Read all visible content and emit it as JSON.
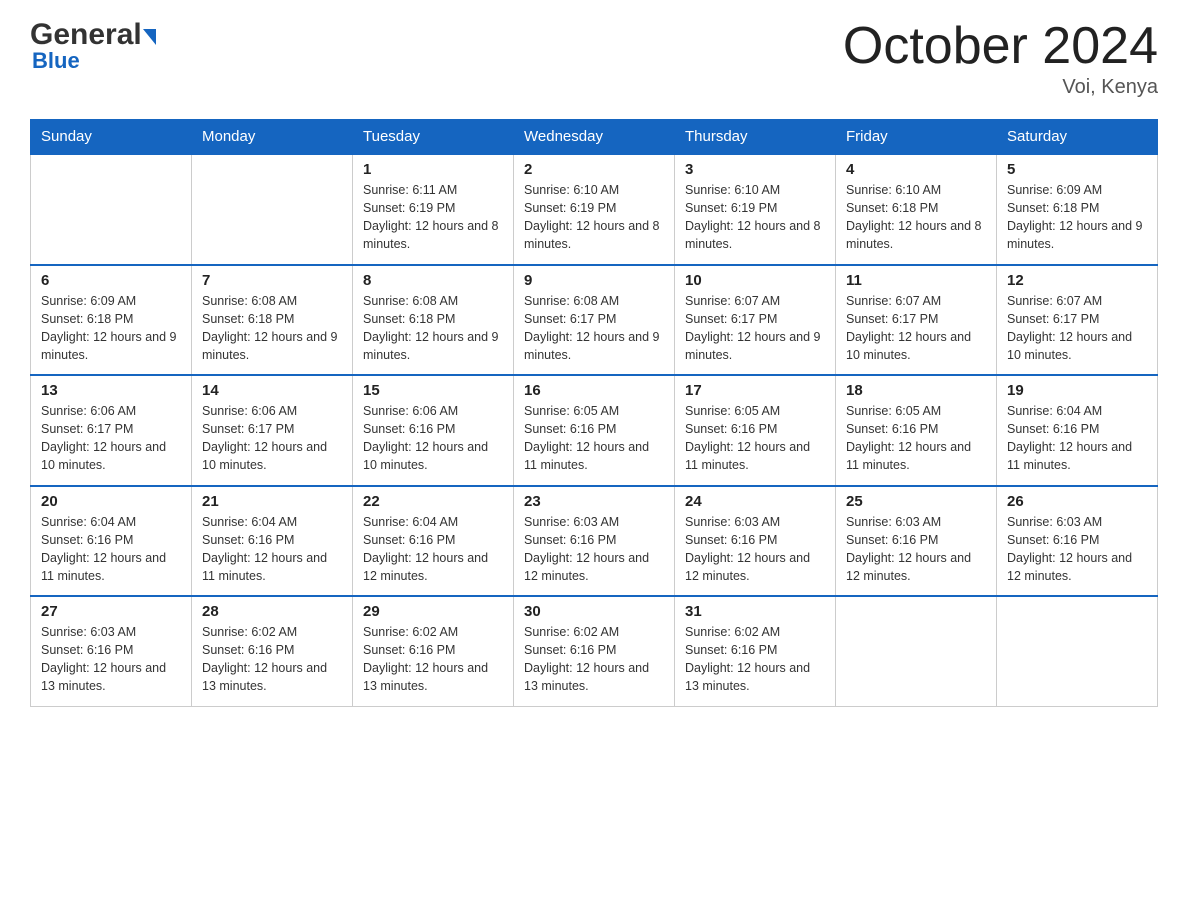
{
  "header": {
    "logo_general": "General",
    "logo_blue": "Blue",
    "month_title": "October 2024",
    "location": "Voi, Kenya"
  },
  "weekdays": [
    "Sunday",
    "Monday",
    "Tuesday",
    "Wednesday",
    "Thursday",
    "Friday",
    "Saturday"
  ],
  "weeks": [
    [
      {
        "day": "",
        "sunrise": "",
        "sunset": "",
        "daylight": ""
      },
      {
        "day": "",
        "sunrise": "",
        "sunset": "",
        "daylight": ""
      },
      {
        "day": "1",
        "sunrise": "Sunrise: 6:11 AM",
        "sunset": "Sunset: 6:19 PM",
        "daylight": "Daylight: 12 hours and 8 minutes."
      },
      {
        "day": "2",
        "sunrise": "Sunrise: 6:10 AM",
        "sunset": "Sunset: 6:19 PM",
        "daylight": "Daylight: 12 hours and 8 minutes."
      },
      {
        "day": "3",
        "sunrise": "Sunrise: 6:10 AM",
        "sunset": "Sunset: 6:19 PM",
        "daylight": "Daylight: 12 hours and 8 minutes."
      },
      {
        "day": "4",
        "sunrise": "Sunrise: 6:10 AM",
        "sunset": "Sunset: 6:18 PM",
        "daylight": "Daylight: 12 hours and 8 minutes."
      },
      {
        "day": "5",
        "sunrise": "Sunrise: 6:09 AM",
        "sunset": "Sunset: 6:18 PM",
        "daylight": "Daylight: 12 hours and 9 minutes."
      }
    ],
    [
      {
        "day": "6",
        "sunrise": "Sunrise: 6:09 AM",
        "sunset": "Sunset: 6:18 PM",
        "daylight": "Daylight: 12 hours and 9 minutes."
      },
      {
        "day": "7",
        "sunrise": "Sunrise: 6:08 AM",
        "sunset": "Sunset: 6:18 PM",
        "daylight": "Daylight: 12 hours and 9 minutes."
      },
      {
        "day": "8",
        "sunrise": "Sunrise: 6:08 AM",
        "sunset": "Sunset: 6:18 PM",
        "daylight": "Daylight: 12 hours and 9 minutes."
      },
      {
        "day": "9",
        "sunrise": "Sunrise: 6:08 AM",
        "sunset": "Sunset: 6:17 PM",
        "daylight": "Daylight: 12 hours and 9 minutes."
      },
      {
        "day": "10",
        "sunrise": "Sunrise: 6:07 AM",
        "sunset": "Sunset: 6:17 PM",
        "daylight": "Daylight: 12 hours and 9 minutes."
      },
      {
        "day": "11",
        "sunrise": "Sunrise: 6:07 AM",
        "sunset": "Sunset: 6:17 PM",
        "daylight": "Daylight: 12 hours and 10 minutes."
      },
      {
        "day": "12",
        "sunrise": "Sunrise: 6:07 AM",
        "sunset": "Sunset: 6:17 PM",
        "daylight": "Daylight: 12 hours and 10 minutes."
      }
    ],
    [
      {
        "day": "13",
        "sunrise": "Sunrise: 6:06 AM",
        "sunset": "Sunset: 6:17 PM",
        "daylight": "Daylight: 12 hours and 10 minutes."
      },
      {
        "day": "14",
        "sunrise": "Sunrise: 6:06 AM",
        "sunset": "Sunset: 6:17 PM",
        "daylight": "Daylight: 12 hours and 10 minutes."
      },
      {
        "day": "15",
        "sunrise": "Sunrise: 6:06 AM",
        "sunset": "Sunset: 6:16 PM",
        "daylight": "Daylight: 12 hours and 10 minutes."
      },
      {
        "day": "16",
        "sunrise": "Sunrise: 6:05 AM",
        "sunset": "Sunset: 6:16 PM",
        "daylight": "Daylight: 12 hours and 11 minutes."
      },
      {
        "day": "17",
        "sunrise": "Sunrise: 6:05 AM",
        "sunset": "Sunset: 6:16 PM",
        "daylight": "Daylight: 12 hours and 11 minutes."
      },
      {
        "day": "18",
        "sunrise": "Sunrise: 6:05 AM",
        "sunset": "Sunset: 6:16 PM",
        "daylight": "Daylight: 12 hours and 11 minutes."
      },
      {
        "day": "19",
        "sunrise": "Sunrise: 6:04 AM",
        "sunset": "Sunset: 6:16 PM",
        "daylight": "Daylight: 12 hours and 11 minutes."
      }
    ],
    [
      {
        "day": "20",
        "sunrise": "Sunrise: 6:04 AM",
        "sunset": "Sunset: 6:16 PM",
        "daylight": "Daylight: 12 hours and 11 minutes."
      },
      {
        "day": "21",
        "sunrise": "Sunrise: 6:04 AM",
        "sunset": "Sunset: 6:16 PM",
        "daylight": "Daylight: 12 hours and 11 minutes."
      },
      {
        "day": "22",
        "sunrise": "Sunrise: 6:04 AM",
        "sunset": "Sunset: 6:16 PM",
        "daylight": "Daylight: 12 hours and 12 minutes."
      },
      {
        "day": "23",
        "sunrise": "Sunrise: 6:03 AM",
        "sunset": "Sunset: 6:16 PM",
        "daylight": "Daylight: 12 hours and 12 minutes."
      },
      {
        "day": "24",
        "sunrise": "Sunrise: 6:03 AM",
        "sunset": "Sunset: 6:16 PM",
        "daylight": "Daylight: 12 hours and 12 minutes."
      },
      {
        "day": "25",
        "sunrise": "Sunrise: 6:03 AM",
        "sunset": "Sunset: 6:16 PM",
        "daylight": "Daylight: 12 hours and 12 minutes."
      },
      {
        "day": "26",
        "sunrise": "Sunrise: 6:03 AM",
        "sunset": "Sunset: 6:16 PM",
        "daylight": "Daylight: 12 hours and 12 minutes."
      }
    ],
    [
      {
        "day": "27",
        "sunrise": "Sunrise: 6:03 AM",
        "sunset": "Sunset: 6:16 PM",
        "daylight": "Daylight: 12 hours and 13 minutes."
      },
      {
        "day": "28",
        "sunrise": "Sunrise: 6:02 AM",
        "sunset": "Sunset: 6:16 PM",
        "daylight": "Daylight: 12 hours and 13 minutes."
      },
      {
        "day": "29",
        "sunrise": "Sunrise: 6:02 AM",
        "sunset": "Sunset: 6:16 PM",
        "daylight": "Daylight: 12 hours and 13 minutes."
      },
      {
        "day": "30",
        "sunrise": "Sunrise: 6:02 AM",
        "sunset": "Sunset: 6:16 PM",
        "daylight": "Daylight: 12 hours and 13 minutes."
      },
      {
        "day": "31",
        "sunrise": "Sunrise: 6:02 AM",
        "sunset": "Sunset: 6:16 PM",
        "daylight": "Daylight: 12 hours and 13 minutes."
      },
      {
        "day": "",
        "sunrise": "",
        "sunset": "",
        "daylight": ""
      },
      {
        "day": "",
        "sunrise": "",
        "sunset": "",
        "daylight": ""
      }
    ]
  ]
}
